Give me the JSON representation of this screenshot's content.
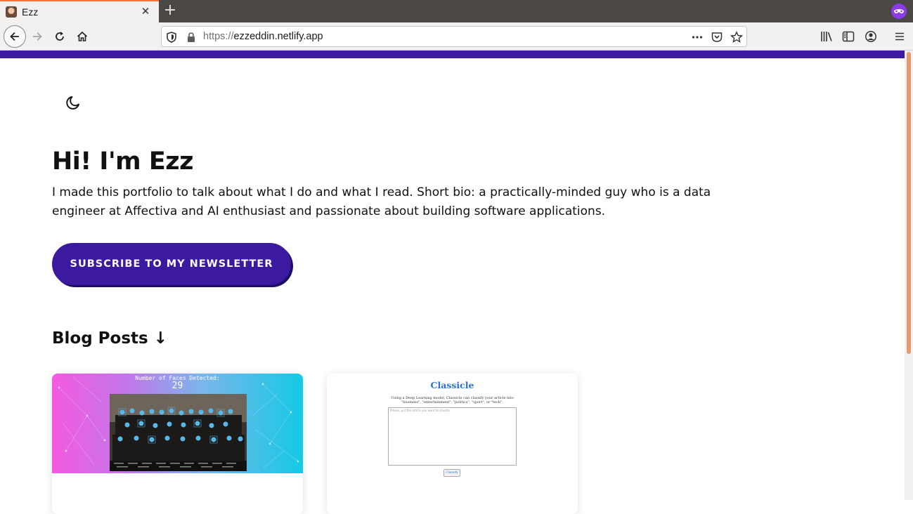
{
  "browser": {
    "tab_title": "Ezz",
    "tab_close": "✕",
    "new_tab": "+",
    "url_protocol": "https://",
    "url_host": "ezzeddin.netlify.app",
    "icons": [
      "back-icon",
      "forward-icon",
      "reload-icon",
      "home-icon",
      "shield-icon",
      "lock-icon",
      "more-icon",
      "pocket-icon",
      "bookmark-star-icon",
      "library-icon",
      "sidebar-icon",
      "account-icon",
      "menu-icon",
      "private-browsing-icon"
    ],
    "accent_color": "#ff7139"
  },
  "page": {
    "accent_color": "#3c1aa1",
    "hero": {
      "title": "Hi! I'm Ezz",
      "bio": "I made this portfolio to talk about what I do and what I read. Short bio: a practically-minded guy who is a data engineer at Affectiva and AI enthusiast and passionate about building software applications."
    },
    "subscribe_label": "SUBSCRIBE TO MY NEWSLETTER",
    "blog_section_title": "Blog Posts ↓",
    "cards": [
      {
        "faces_label": "Number of Faces Detected:",
        "faces_count": "29"
      },
      {
        "app_title": "Classicle",
        "app_description": "Using a Deep Learning model, Classicle can classify your article into \"business\", \"entertainment\", \"politics\", \"sport\", or \"tech\".",
        "textarea_placeholder": "Please, put the article you want to classify",
        "button_label": "Classify"
      }
    ]
  }
}
